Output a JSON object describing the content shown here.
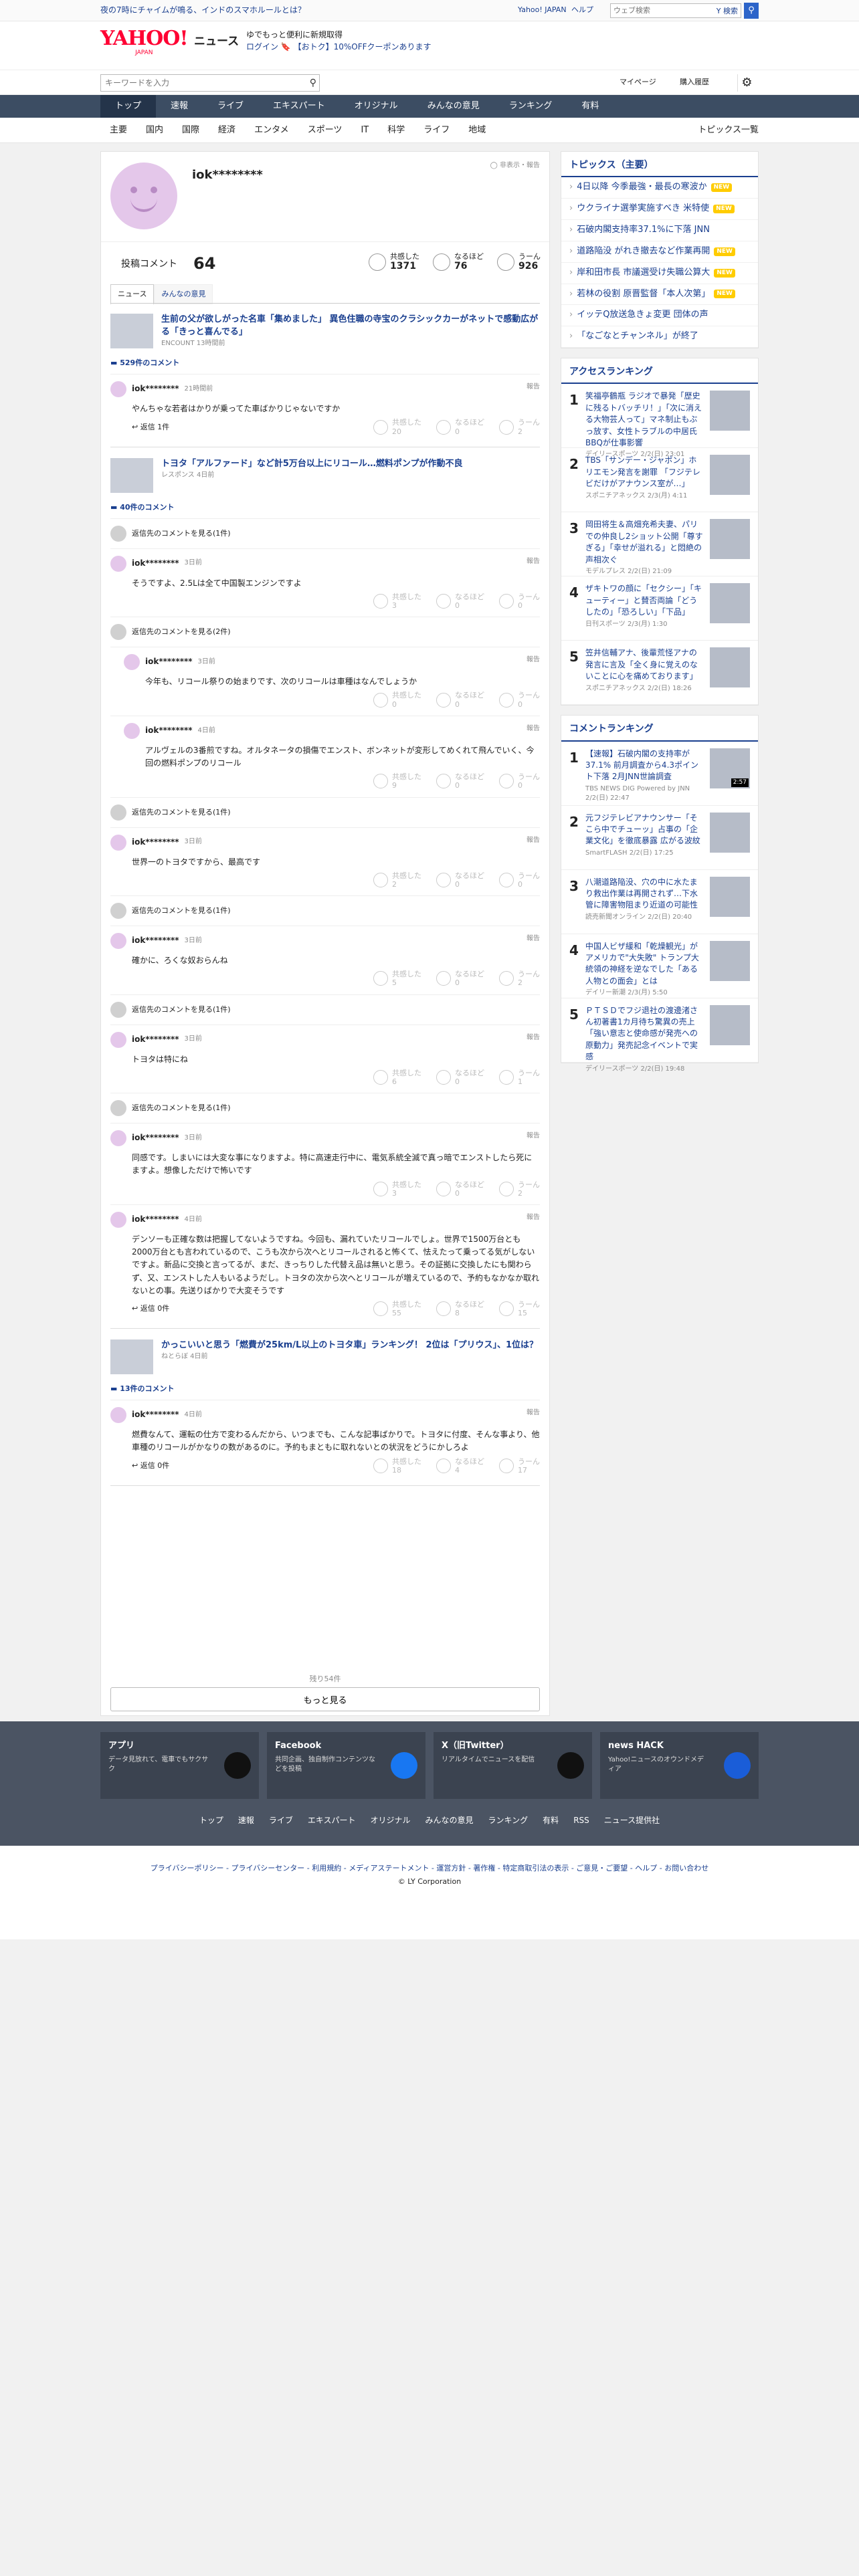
{
  "topbar": {
    "promo": "夜の7時にチャイムが鳴る、インドのスマホルールとは？",
    "links": [
      "Yahoo! JAPAN",
      "ヘルプ"
    ],
    "search_placeholder": "ウェブ検索",
    "search_button": "検索"
  },
  "brand": {
    "logo": "YAHOO!",
    "logo_sub": "JAPAN",
    "service": "ニュース",
    "promo1": "ゆでもっと便利に新規取得",
    "promo2": "ログイン 🔖 【おトク】10%OFFクーポンあります"
  },
  "searchbar": {
    "placeholder": "キーワードを入力",
    "mypage": "マイページ",
    "history": "購入履歴"
  },
  "nav1": [
    "トップ",
    "速報",
    "ライブ",
    "エキスパート",
    "オリジナル",
    "みんなの意見",
    "ランキング",
    "有料"
  ],
  "nav2": [
    "主要",
    "国内",
    "国際",
    "経済",
    "エンタメ",
    "スポーツ",
    "IT",
    "科学",
    "ライフ",
    "地域"
  ],
  "nav2_right": "トピックス一覧",
  "profile": {
    "name": "iok********",
    "hide_label": "非表示・報告",
    "comment_label": "投稿コメント",
    "comment_count": "64",
    "reactions": [
      {
        "label": "共感した",
        "value": "1371"
      },
      {
        "label": "なるほど",
        "value": "76"
      },
      {
        "label": "うーん",
        "value": "926"
      }
    ],
    "tabs": [
      "ニュース",
      "みんなの意見"
    ]
  },
  "labels": {
    "report": "報告",
    "agree": "共感した",
    "naruhodo": "なるほど",
    "uun": "うーん",
    "show_parent": "返信先のコメントを見る(1件)",
    "show_parent2": "返信先のコメントを見る(2件)",
    "more": "もっと見る",
    "remaining": "残り54件"
  },
  "articles": [
    {
      "title": "生前の父が欲しがった名車「集めました」 異色住職の寺宝のクラシックカーがネットで感動広がる「きっと喜んでる」",
      "source": "ENCOUNT 13時間前",
      "comment_count": "529件のコメント",
      "comments": [
        {
          "user": "iok********",
          "time": "21時間前",
          "text": "やんちゃな若者はかりが乗ってた車ばかりじゃないですか",
          "agree": "20",
          "naruhodo": "0",
          "uun": "2",
          "reply": "返信 1件"
        }
      ]
    },
    {
      "title": "トヨタ「アルファード」など計5万台以上にリコール…燃料ポンプが作動不良",
      "source": "レスポンス 4日前",
      "comment_count": "40件のコメント",
      "comments": [
        {
          "parent": "返信先のコメントを見る(1件)",
          "user": "iok********",
          "time": "3日前",
          "text": "そうですよ、2.5Lは全て中国製エンジンですよ",
          "agree": "3",
          "naruhodo": "0",
          "uun": "0"
        },
        {
          "parent": "返信先のコメントを見る(2件)",
          "user": "iok********",
          "time": "3日前",
          "text": "今年も、リコール祭りの始まりです、次のリコールは車種はなんでしょうか",
          "agree": "0",
          "naruhodo": "0",
          "uun": "0",
          "nested": true
        },
        {
          "user": "iok********",
          "time": "4日前",
          "text": "アルヴェルの3番煎ですね。オルタネータの損傷でエンスト、ボンネットが変形してめくれて飛んでいく、今回の燃料ポンプのリコール",
          "agree": "9",
          "naruhodo": "0",
          "uun": "0",
          "nested": true
        },
        {
          "parent": "返信先のコメントを見る(1件)",
          "user": "iok********",
          "time": "3日前",
          "text": "世界一のトヨタですから、最高です",
          "agree": "2",
          "naruhodo": "0",
          "uun": "0"
        },
        {
          "parent": "返信先のコメントを見る(1件)",
          "user": "iok********",
          "time": "3日前",
          "text": "確かに、ろくな奴おらんね",
          "agree": "5",
          "naruhodo": "0",
          "uun": "2"
        },
        {
          "parent": "返信先のコメントを見る(1件)",
          "user": "iok********",
          "time": "3日前",
          "text": "トヨタは特にね",
          "agree": "6",
          "naruhodo": "0",
          "uun": "1"
        },
        {
          "parent": "返信先のコメントを見る(1件)",
          "user": "iok********",
          "time": "3日前",
          "text": "同感です。しまいには大変な事になりますよ。特に高速走行中に、電気系統全滅で真っ暗でエンストしたら死にますよ。想像しただけで怖いです",
          "agree": "3",
          "naruhodo": "0",
          "uun": "2"
        },
        {
          "user": "iok********",
          "time": "4日前",
          "text": "デンソーも正確な数は把握してないようですね。今回も、漏れていたリコールでしょ。世界で1500万台とも2000万台とも言われているので、こうも次から次へとリコールされると怖くて、怯えたって乗ってる気がしないですよ。新品に交換と言ってるが、まだ、きっちりした代替え品は無いと思う。その証拠に交換したにも関わらず、又、エンストした人もいるようだし。トヨタの次から次へとリコールが増えているので、予約もなかなか取れないとの事。先送りばかりで大変そうです",
          "agree": "55",
          "naruhodo": "8",
          "uun": "15",
          "reply": "返信 0件"
        }
      ]
    },
    {
      "title": "かっこいいと思う「燃費が25km/L以上のトヨタ車」ランキング！ 2位は「プリウス」、1位は？",
      "source": "ねとらぼ 4日前",
      "comment_count": "13件のコメント",
      "comments": [
        {
          "user": "iok********",
          "time": "4日前",
          "text": "燃費なんて、運転の仕方で変わるんだから、いつまでも、こんな記事ばかりで。トヨタに付度、そんな事より、他車種のリコールがかなりの数があるのに。予約もまともに取れないとの状況をどうにかしろよ",
          "agree": "18",
          "naruhodo": "4",
          "uun": "17",
          "reply": "返信 0件"
        }
      ]
    }
  ],
  "sidebar": {
    "topics_title": "トピックス（主要）",
    "topics": [
      {
        "text": "4日以降 今季最強・最長の寒波か",
        "badge": "NEW"
      },
      {
        "text": "ウクライナ選挙実施すべき 米特使",
        "badge": "NEW"
      },
      {
        "text": "石破内閣支持率37.1%に下落 JNN",
        "badge": ""
      },
      {
        "text": "道路陥没 がれき撤去など作業再開",
        "badge": "NEW"
      },
      {
        "text": "岸和田市長 市議選受け失職公算大",
        "badge": "NEW"
      },
      {
        "text": "若林の役割 原晋監督「本人次第」",
        "badge": "NEW"
      },
      {
        "text": "イッテQ放送急きょ変更 団体の声",
        "badge": ""
      },
      {
        "text": "「なごなとチャンネル」が終了",
        "badge": ""
      }
    ],
    "access_title": "アクセスランキング",
    "access": [
      {
        "num": "1",
        "text": "笑福亭鶴瓶 ラジオで暴発「歴史に残るトバッチリ！」「次に消える大物芸人って」マネ制止もぶっ放す、女性トラブルの中居氏BBQが仕事影響",
        "src": "デイリースポーツ 2/2(日) 23:01"
      },
      {
        "num": "2",
        "text": "TBS「サンデー・ジャポン」ホリエモン発言を謝罪 「フジテレビだけがアナウンス室が…」",
        "src": "スポニチアネックス 2/3(月) 4:11"
      },
      {
        "num": "3",
        "text": "岡田将生＆高畑充希夫妻、パリでの仲良し2ショット公開「尊すぎる」「幸せが溢れる」と悶絶の声相次ぐ",
        "src": "モデルプレス 2/2(日) 21:09"
      },
      {
        "num": "4",
        "text": "ザキトワの顔に「セクシー」「キューティー」と賛否両論「どうしたの」「恐ろしい」「下品」",
        "src": "日刊スポーツ 2/3(月) 1:30"
      },
      {
        "num": "5",
        "text": "笠井信輔アナ、後輩荒怪アナの発言に言及「全く身に覚えのないことに心を痛めております」",
        "src": "スポニチアネックス 2/2(日) 18:26"
      }
    ],
    "comment_title": "コメントランキング",
    "comment_rank": [
      {
        "num": "1",
        "text": "【速報】石破内閣の支持率が37.1% 前月調査から4.3ポイント下落 2月JNN世論調査",
        "src": "TBS NEWS DIG Powered by JNN 2/2(日) 22:47",
        "dur": "2:57"
      },
      {
        "num": "2",
        "text": "元フジテレビアナウンサー「そこら中でチューッ」占事の「企業文化」を徹底暴露 広がる波紋",
        "src": "SmartFLASH 2/2(日) 17:25",
        "dur": ""
      },
      {
        "num": "3",
        "text": "八潮道路陥没、穴の中に水たまり救出作業は再開されず…下水管に障害物阻まり近道の可能性",
        "src": "読売新聞オンライン 2/2(日) 20:40",
        "dur": ""
      },
      {
        "num": "4",
        "text": "中国人ビザ緩和「乾燥観光」がアメリカで\"大失敗\" トランプ大統領の神経を逆なでした「ある人物との面会」とは",
        "src": "デイリー新潮 2/3(月) 5:50",
        "dur": ""
      },
      {
        "num": "5",
        "text": "ＰＴＳＤでフジ退社の渡邊渚さん初著書1カ月待ち驚異の売上「強い意志と使命感が発売への原動力」発売記念イベントで実感",
        "src": "デイリースポーツ 2/2(日) 19:48",
        "dur": ""
      }
    ]
  },
  "footer": {
    "apps": [
      {
        "title": "アプリ",
        "desc": "データ見放れて、電車でもサクサク"
      },
      {
        "title": "Facebook",
        "desc": "共同企画、独自制作コンテンツなどを投稿"
      },
      {
        "title": "X（旧Twitter）",
        "desc": "リアルタイムでニュースを配信"
      },
      {
        "title": "news HACK",
        "desc": "Yahoo!ニュースのオウンドメディア"
      }
    ],
    "nav": [
      "トップ",
      "速報",
      "ライブ",
      "エキスパート",
      "オリジナル",
      "みんなの意見",
      "ランキング",
      "有料",
      "RSS",
      "ニュース提供社"
    ],
    "legal": "プライバシーポリシー - プライバシーセンター - 利用規約 - メディアステートメント - 運営方針 - 著作権 - 特定商取引法の表示 - ご意見・ご要望 - ヘルプ - お問い合わせ",
    "copyright": "© LY Corporation"
  }
}
